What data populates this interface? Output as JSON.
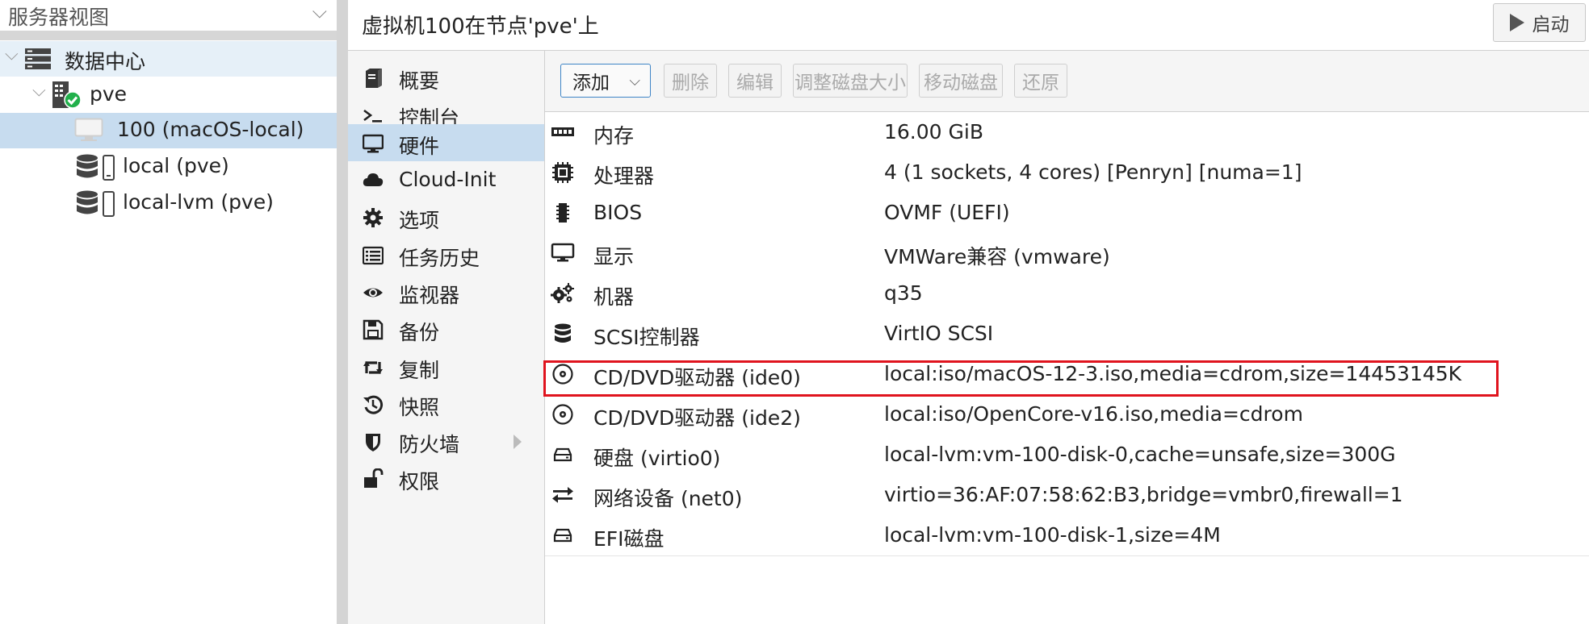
{
  "tree": {
    "view_label": "服务器视图",
    "datacenter": "数据中心",
    "node": "pve",
    "vm": "100 (macOS-local)",
    "storage": [
      "local (pve)",
      "local-lvm (pve)"
    ]
  },
  "header": {
    "title": "虚拟机100在节点'pve'上",
    "start_label": "启动"
  },
  "nav": [
    {
      "label": "概要",
      "icon": "book-icon"
    },
    {
      "label": "控制台",
      "icon": "terminal-icon"
    },
    {
      "label": "硬件",
      "icon": "monitor-icon",
      "active": true
    },
    {
      "label": "Cloud-Init",
      "icon": "cloud-icon"
    },
    {
      "label": "选项",
      "icon": "gear-icon"
    },
    {
      "label": "任务历史",
      "icon": "list-icon"
    },
    {
      "label": "监视器",
      "icon": "eye-icon"
    },
    {
      "label": "备份",
      "icon": "floppy-icon"
    },
    {
      "label": "复制",
      "icon": "retweet-icon"
    },
    {
      "label": "快照",
      "icon": "history-icon"
    },
    {
      "label": "防火墙",
      "icon": "shield-icon"
    },
    {
      "label": "权限",
      "icon": "unlock-icon"
    }
  ],
  "toolbar": {
    "add": "添加",
    "delete": "删除",
    "edit": "编辑",
    "resize": "调整磁盘大小",
    "move": "移动磁盘",
    "revert": "还原"
  },
  "hardware": [
    {
      "name": "内存",
      "value": "16.00 GiB",
      "icon": "memory-icon"
    },
    {
      "name": "处理器",
      "value": "4 (1 sockets, 4 cores) [Penryn] [numa=1]",
      "icon": "cpu-icon"
    },
    {
      "name": "BIOS",
      "value": "OVMF (UEFI)",
      "icon": "microchip-icon"
    },
    {
      "name": "显示",
      "value": "VMWare兼容 (vmware)",
      "icon": "display-icon"
    },
    {
      "name": "机器",
      "value": "q35",
      "icon": "gears-icon"
    },
    {
      "name": "SCSI控制器",
      "value": "VirtIO SCSI",
      "icon": "database-icon"
    },
    {
      "name": "CD/DVD驱动器 (ide0)",
      "value": "local:iso/macOS-12-3.iso,media=cdrom,size=14453145K",
      "icon": "cdrom-icon"
    },
    {
      "name": "CD/DVD驱动器 (ide2)",
      "value": "local:iso/OpenCore-v16.iso,media=cdrom",
      "icon": "cdrom-icon"
    },
    {
      "name": "硬盘 (virtio0)",
      "value": "local-lvm:vm-100-disk-0,cache=unsafe,size=300G",
      "icon": "hdd-icon"
    },
    {
      "name": "网络设备 (net0)",
      "value": "virtio=36:AF:07:58:62:B3,bridge=vmbr0,firewall=1",
      "icon": "exchange-icon"
    },
    {
      "name": "EFI磁盘",
      "value": "local-lvm:vm-100-disk-1,size=4M",
      "icon": "hdd-icon"
    }
  ],
  "colors": {
    "selected_row": "#c7dcef",
    "highlight_border": "#e0141e",
    "status_ok": "#21b04b"
  }
}
